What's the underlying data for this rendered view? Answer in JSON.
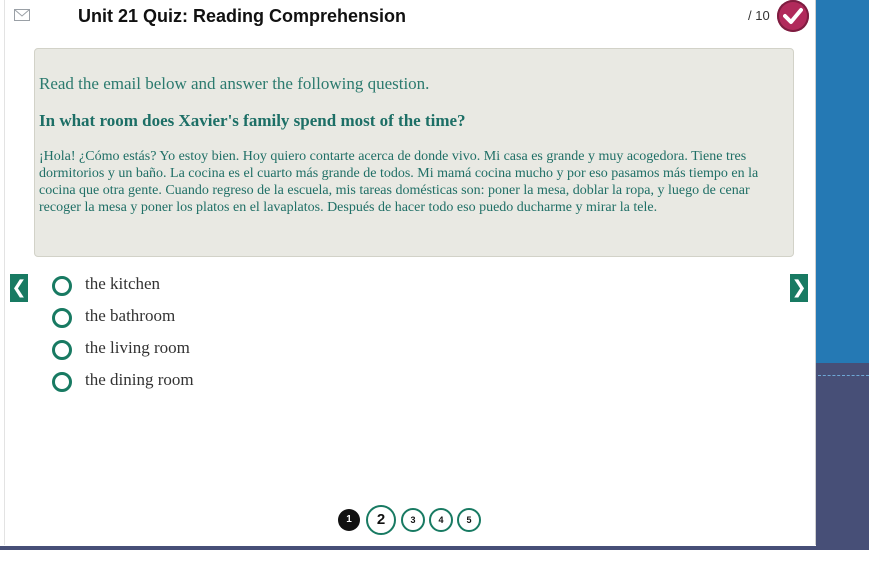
{
  "header": {
    "title": "Unit 21 Quiz: Reading Comprehension",
    "score": "/ 10"
  },
  "question": {
    "instruction": "Read the email below and answer the following question.",
    "prompt": "In what room does Xavier's family spend most of the time?",
    "passage": "¡Hola! ¿Cómo estás? Yo estoy bien. Hoy quiero contarte acerca de donde vivo. Mi casa es grande y muy acogedora. Tiene tres dormitorios y un baño. La cocina es el cuarto más grande de todos. Mi mamá cocina mucho y por eso pasamos más tiempo en la cocina que otra gente. Cuando regreso de la escuela, mis tareas domésticas son: poner la mesa, doblar la ropa, y luego de cenar recoger la mesa y poner los platos en el lavaplatos. Después de hacer todo eso puedo ducharme y mirar la tele."
  },
  "choices": [
    {
      "label": "the kitchen"
    },
    {
      "label": "the bathroom"
    },
    {
      "label": "the living room"
    },
    {
      "label": "the dining room"
    }
  ],
  "navigation": {
    "prev_icon": "❮",
    "next_icon": "❯"
  },
  "pager": {
    "pages": [
      "1",
      "2",
      "3",
      "4",
      "5"
    ],
    "current": "2"
  },
  "colors": {
    "accent": "#187a62",
    "badge": "#b12a5b",
    "side_blue": "#2579b4",
    "side_navy": "#474f77"
  }
}
